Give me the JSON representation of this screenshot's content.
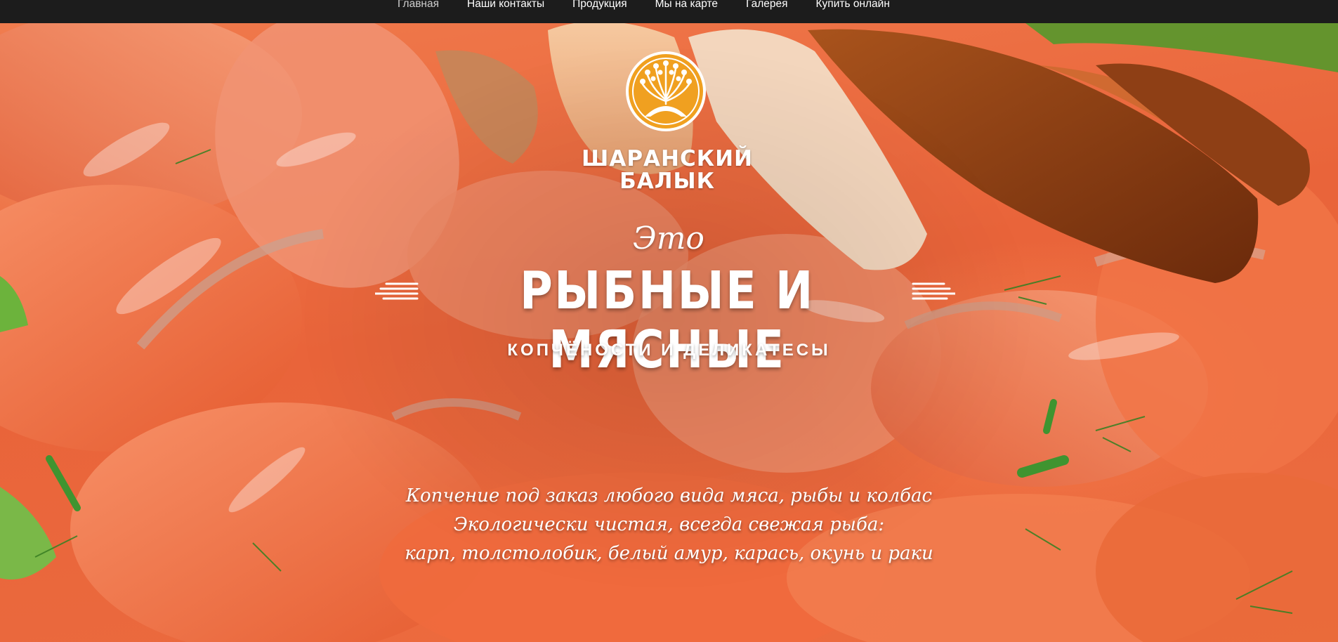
{
  "nav": {
    "items": [
      {
        "label": "Главная",
        "active": true
      },
      {
        "label": "Наши контакты",
        "active": false
      },
      {
        "label": "Продукция",
        "active": false
      },
      {
        "label": "Мы на карте",
        "active": false
      },
      {
        "label": "Галерея",
        "active": false
      },
      {
        "label": "Купить онлайн",
        "active": false
      }
    ]
  },
  "brand": {
    "line1": "ШАРАНСКИЙ",
    "line2": "БАЛЫК",
    "logo_icon": "tree-sun-icon",
    "logo_color": "#f0a020"
  },
  "hero": {
    "intro": "Это",
    "headline": "РЫБНЫЕ И МЯСНЫЕ",
    "subheadline": "КОПЧЁНОСТИ И ДЕЛИКАТЕСЫ",
    "description": [
      "Копчение под заказ любого вида мяса, рыбы и колбас",
      "Экологически чистая, всегда свежая рыба:",
      "карп, толстолобик, белый амур, карась, окунь и раки"
    ]
  },
  "colors": {
    "nav_bg": "#1c1c1c",
    "salmon": "#ec6d40",
    "text": "#ffffff"
  }
}
